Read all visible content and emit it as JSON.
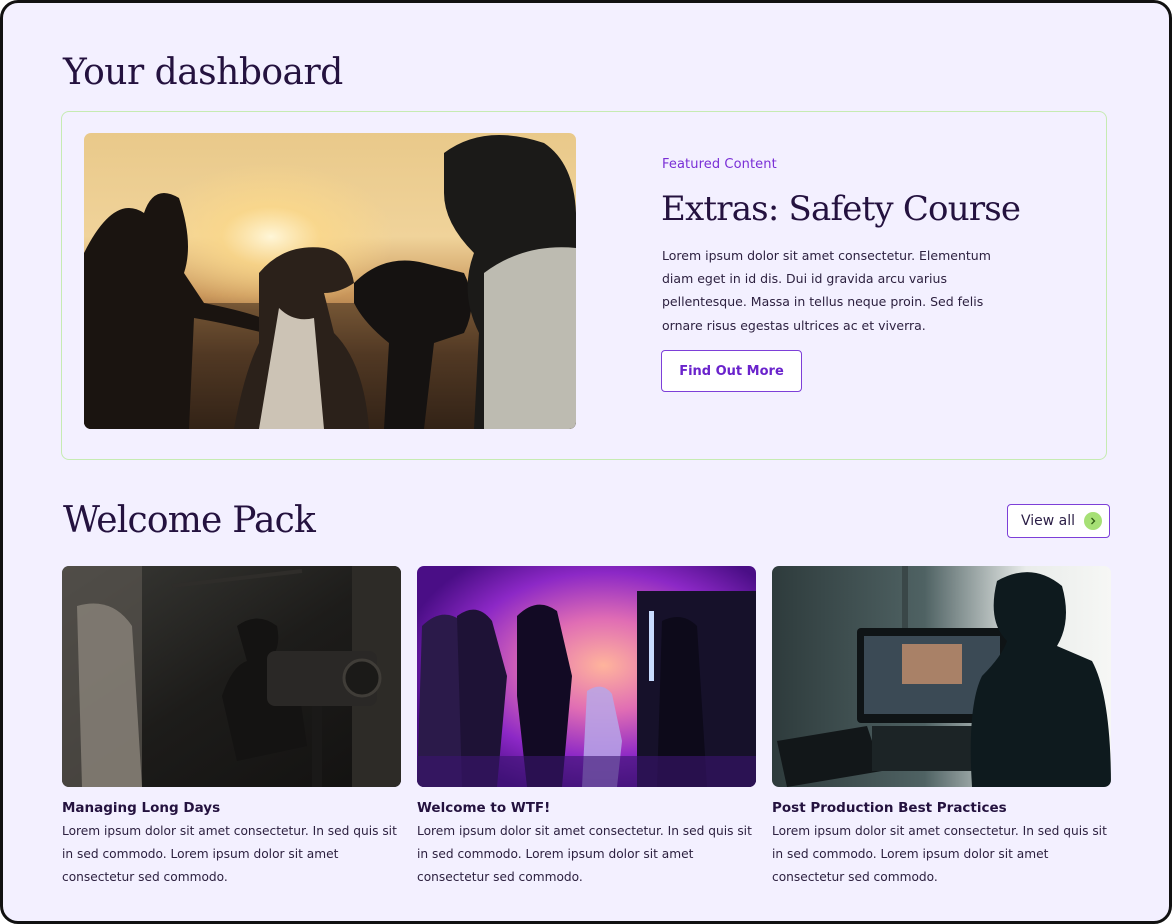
{
  "dashboard": {
    "title": "Your dashboard"
  },
  "featured": {
    "eyebrow": "Featured Content",
    "title": "Extras: Safety Course",
    "description": "Lorem ipsum dolor sit amet consectetur. Elementum diam eget in id dis. Dui id gravida arcu varius pellentesque. Massa in tellus neque proin. Sed felis ornare risus egestas ultrices ac et viverra.",
    "button_label": "Find Out More",
    "image_icon": "film-crew-sunset-photo"
  },
  "welcome_pack": {
    "title": "Welcome Pack",
    "view_all_label": "View all",
    "view_all_icon": "chevron-right-icon",
    "cards": [
      {
        "title": "Managing Long Days",
        "description": "Lorem ipsum dolor sit amet consectetur. In sed quis sit in sed commodo. Lorem ipsum dolor sit amet consectetur sed commodo.",
        "image_icon": "camera-operator-photo"
      },
      {
        "title": "Welcome to WTF!",
        "description": "Lorem ipsum dolor sit amet consectetur. In sed quis sit in sed commodo. Lorem ipsum dolor sit amet consectetur sed commodo.",
        "image_icon": "neon-film-set-photo"
      },
      {
        "title": "Post Production Best Practices",
        "description": "Lorem ipsum dolor sit amet consectetur. In sed quis sit in sed commodo. Lorem ipsum dolor sit amet consectetur sed commodo.",
        "image_icon": "editing-suite-photo"
      }
    ]
  },
  "colors": {
    "background": "#f3f0ff",
    "heading": "#24123f",
    "accent_purple": "#7a2fd6",
    "accent_green": "#a6e075",
    "card_border": "#c6ebb2"
  }
}
